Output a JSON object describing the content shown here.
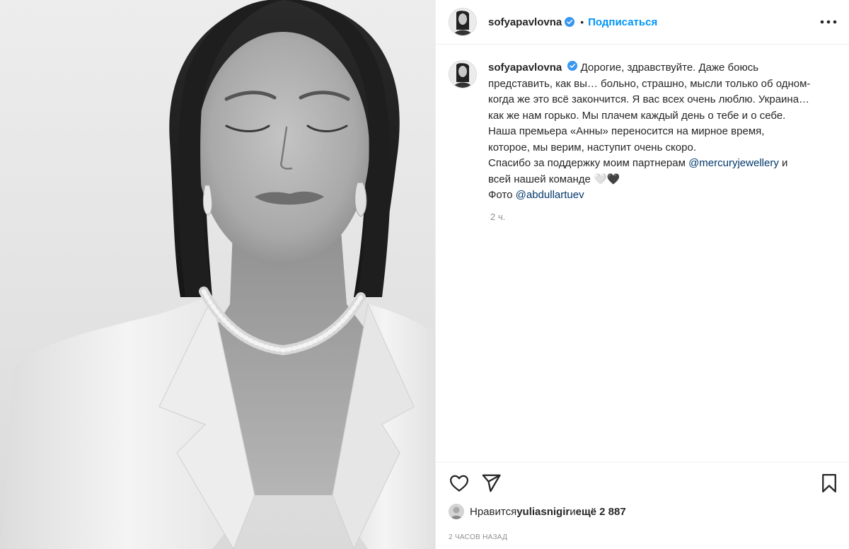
{
  "post": {
    "author": {
      "username": "sofyapavlovna",
      "verified": true,
      "follow_label": "Подписаться",
      "separator": "•"
    },
    "caption": {
      "line1": "Дорогие, здравствуйте. Даже боюсь",
      "line2": "представить, как вы… больно, страшно, мысли только об одном-",
      "line3": "когда же это всё закончится. Я вас всех очень люблю. Украина…",
      "line4": "как же нам горько. Мы плачем каждый день о тебе и о себе.",
      "line5": "Наша премьера «Анны» переносится на мирное время,",
      "line6": "которое, мы верим, наступит очень скоро.",
      "line7_prefix": "Спасибо за поддержку моим партнерам ",
      "mention1": "@mercuryjewellery",
      "line7_suffix": " и",
      "line8": "всей нашей команде ",
      "emoji": "🤍🖤",
      "line9_prefix": "Фото ",
      "mention2": "@abdullartuev"
    },
    "caption_age": "2 ч.",
    "likes": {
      "prefix": "Нравится ",
      "liker": "yuliasnigir",
      "middle": " и ",
      "others": "ещё 2 887"
    },
    "timestamp": "2 ЧАСОВ НАЗАД"
  },
  "icons": {
    "more": "more-horizontal-icon",
    "like": "heart-icon",
    "share": "send-icon",
    "save": "bookmark-icon",
    "verified": "verified-badge-icon"
  },
  "colors": {
    "accent": "#0095f6",
    "verified": "#3897f0",
    "mention": "#00376b",
    "muted": "#8e8e8e"
  }
}
